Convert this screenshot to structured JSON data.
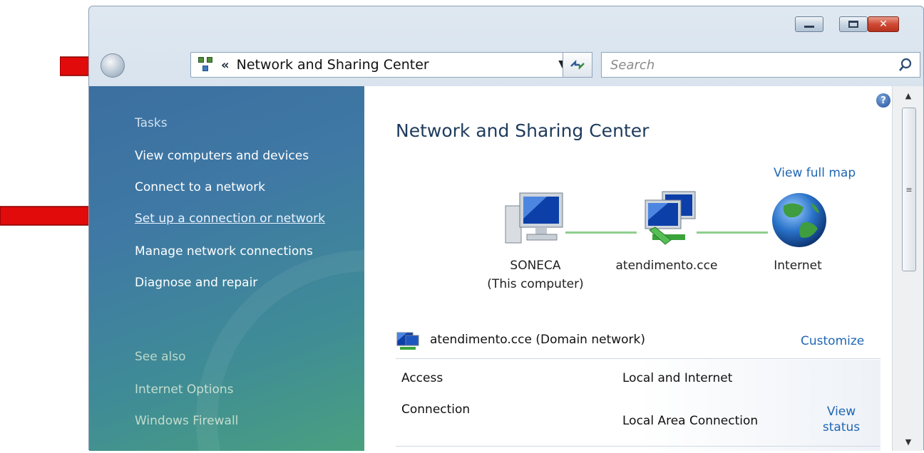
{
  "window": {
    "address_path_chevron": "«",
    "address_path": "Network and Sharing Center",
    "search_placeholder": "Search",
    "close_glyph": "✕"
  },
  "sidebar": {
    "tasks_heading": "Tasks",
    "tasks": [
      {
        "label": "View computers and devices"
      },
      {
        "label": "Connect to a network"
      },
      {
        "label": "Set up a connection or network"
      },
      {
        "label": "Manage network connections"
      },
      {
        "label": "Diagnose and repair"
      }
    ],
    "see_also_heading": "See also",
    "see_also": [
      {
        "label": "Internet Options"
      },
      {
        "label": "Windows Firewall"
      }
    ]
  },
  "main": {
    "title": "Network and Sharing Center",
    "view_full_map": "View full map",
    "map_nodes": [
      {
        "name": "SONECA",
        "sub": "(This computer)",
        "icon": "computer-icon"
      },
      {
        "name": "atendimento.cce",
        "icon": "network-icon"
      },
      {
        "name": "Internet",
        "icon": "globe-icon"
      }
    ],
    "network": {
      "name": "atendimento.cce (Domain network)",
      "customize": "Customize",
      "rows": [
        {
          "label": "Access",
          "value": "Local and Internet"
        },
        {
          "label": "Connection",
          "value": "Local Area Connection"
        }
      ],
      "view_status_line1": "View",
      "view_status_line2": "status"
    }
  },
  "colors": {
    "link": "#1f66b4",
    "annotation_arrow": "#e10b0b",
    "sidebar_top": "#3b6fa0",
    "sidebar_bottom": "#4aa07f"
  }
}
